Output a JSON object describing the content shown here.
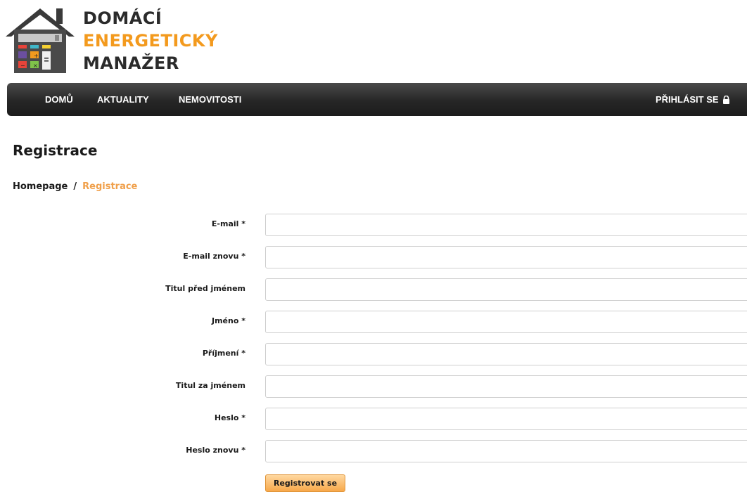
{
  "logo": {
    "line1": "DOMÁCÍ",
    "line2": "ENERGETICKÝ",
    "line3": "MANAŽER",
    "icon": "house-calculator-logo"
  },
  "nav": {
    "items": [
      {
        "label": "DOMŮ"
      },
      {
        "label": "AKTUALITY"
      },
      {
        "label": "NEMOVITOSTI"
      }
    ],
    "login_label": "PŘIHLÁSIT SE",
    "login_icon": "lock-icon"
  },
  "page": {
    "title": "Registrace"
  },
  "breadcrumb": {
    "home": "Homepage",
    "separator": "/",
    "current": "Registrace"
  },
  "form": {
    "fields": [
      {
        "label": "E-mail *",
        "value": ""
      },
      {
        "label": "E-mail znovu *",
        "value": ""
      },
      {
        "label": "Titul před jménem",
        "value": ""
      },
      {
        "label": "Jméno *",
        "value": ""
      },
      {
        "label": "Příjmení *",
        "value": ""
      },
      {
        "label": "Titul za jménem",
        "value": ""
      },
      {
        "label": "Heslo *",
        "value": ""
      },
      {
        "label": "Heslo znovu *",
        "value": ""
      }
    ],
    "submit_label": "Registrovat se"
  },
  "colors": {
    "accent": "#f39a1e",
    "nav_bg": "#262626",
    "button": "#f7a84a"
  }
}
